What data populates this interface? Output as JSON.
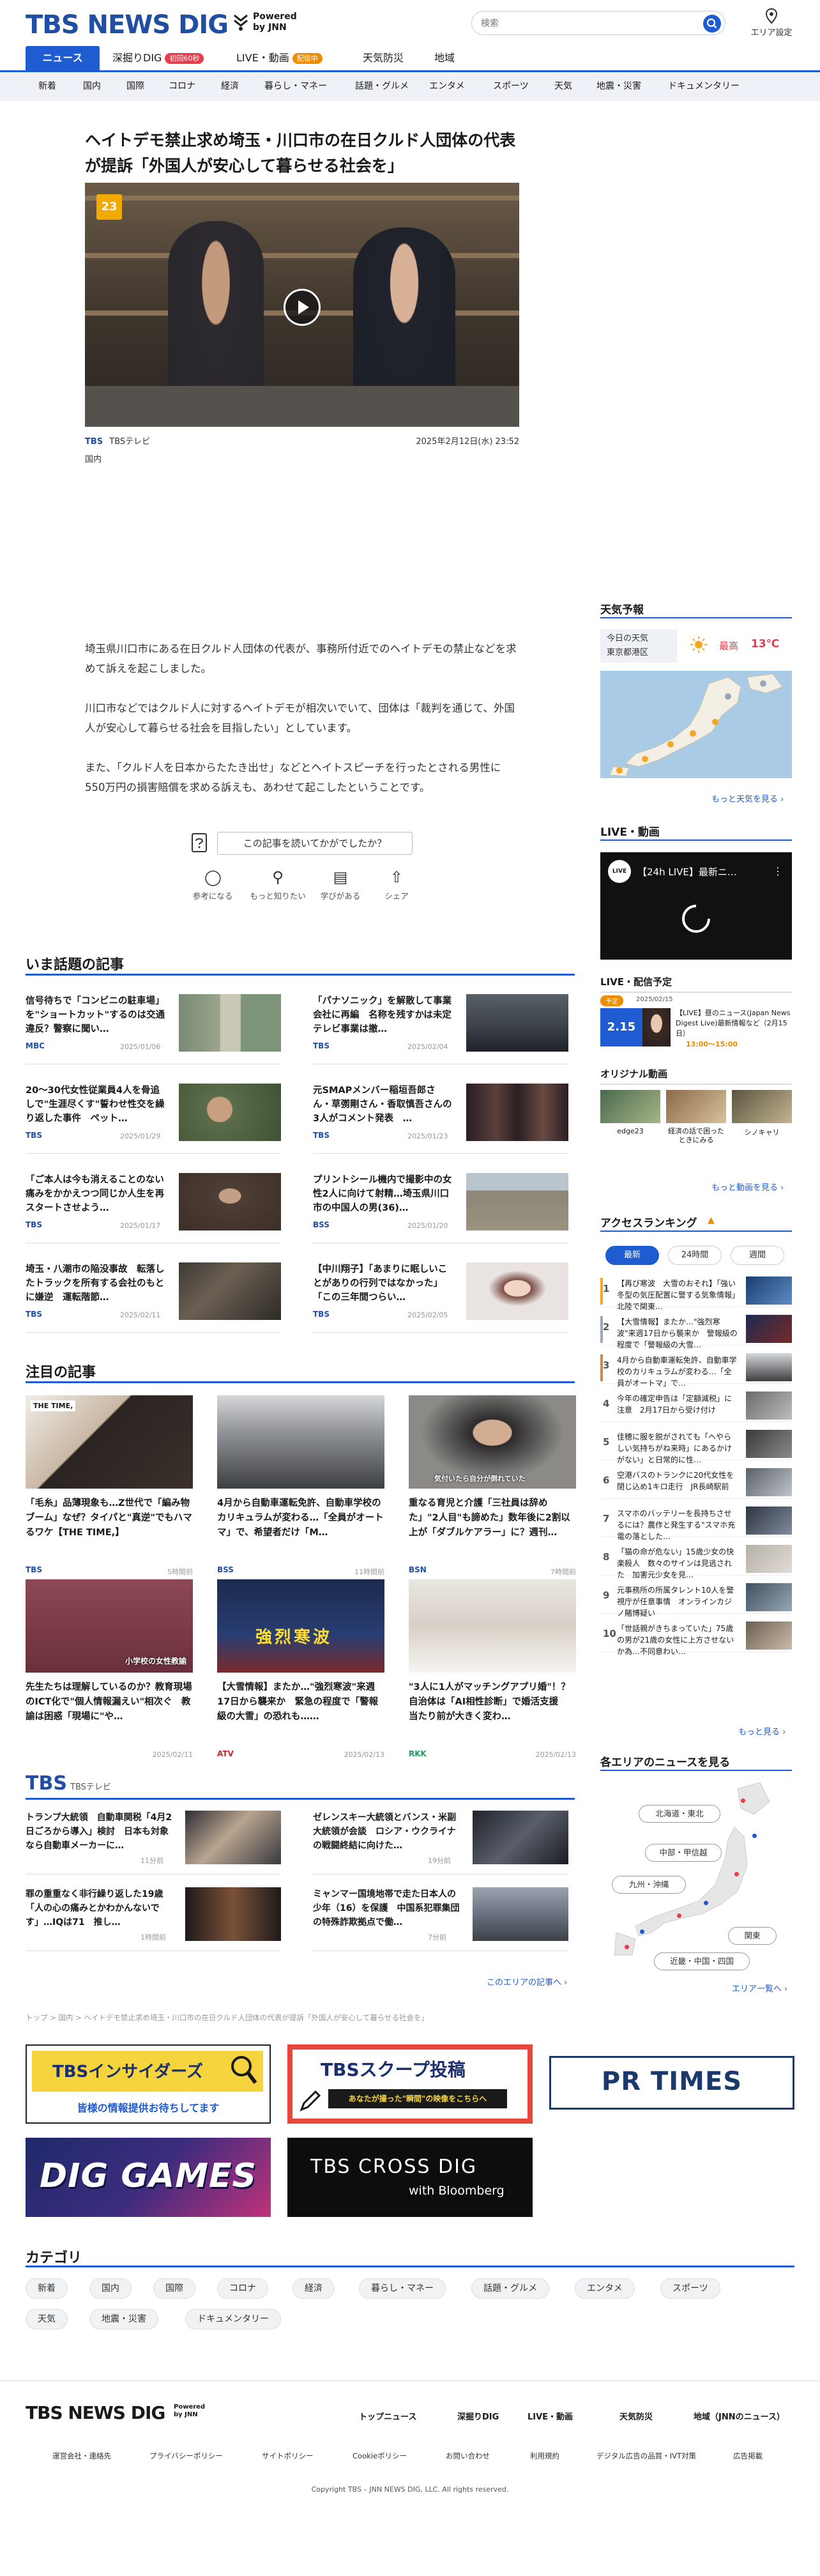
{
  "header": {
    "logo": "TBS NEWS DIG",
    "powered": "Powered",
    "by": "by JNN",
    "search_placeholder": "検索",
    "area_label": "エリア設定"
  },
  "nav": {
    "news": "ニュース",
    "deep_dig": "深掘りDIG",
    "deep_badge": "初回60秒",
    "live": "LIVE・動画",
    "live_badge": "配信中",
    "weather": "天気防災",
    "region": "地域"
  },
  "subnav": [
    "新着",
    "国内",
    "国際",
    "コロナ",
    "経済",
    "暮らし・マネー",
    "話題・グルメ",
    "エンタメ",
    "スポーツ",
    "天気",
    "地震・災害",
    "ドキュメンタリー"
  ],
  "article": {
    "title": "ヘイトデモ禁止求め埼玉・川口市の在日クルド人団体の代表が提訴「外国人が安心して暮らせる社会を」",
    "video_logo": "23",
    "source_logo": "TBS",
    "source_name": "TBSテレビ",
    "date": "2025年2月12日(水) 23:52",
    "category": "国内",
    "p1": "埼玉県川口市にある在日クルド人団体の代表が、事務所付近でのヘイトデモの禁止などを求めて訴えを起こしました。",
    "p2": "川口市などではクルド人に対するヘイトデモが相次いでいて、団体は「裁判を通じて、外国人が安心して暮らせる社会を目指したい」としています。",
    "p3": "また、「クルド人を日本からたたき出せ」などとヘイトスピーチを行ったとされる男性に550万円の損害賠償を求める訴えも、あわせて起こしたということです。",
    "survey": "この記事を読いてかがでしたか？",
    "reactions": [
      "参考になる",
      "もっと知りたい",
      "学びがある",
      "シェア"
    ]
  },
  "trending": {
    "heading": "いま話題の記事",
    "items": [
      {
        "title": "信号待ちで「コンビニの駐車場」を\"ショートカット\"するのは交通違反？警察に聞い…",
        "src": "MBC",
        "date": "2025/01/06"
      },
      {
        "title": "「パナソニック」を解散して事業会社に再編　名称を残すかは未定　テレビ事業は撤…",
        "src": "TBS",
        "date": "2025/02/04"
      },
      {
        "title": "20〜30代女性従業員4人を骨追しで\"生涯尽くす\"誓わせ性交を繰り返した事件　ペット…",
        "src": "TBS",
        "date": "2025/01/29"
      },
      {
        "title": "元SMAPメンバー稲垣吾郎さん・草彅剛さん・香取慎吾さんの3人がコメント発表　…",
        "src": "TBS",
        "date": "2025/01/23"
      },
      {
        "title": "「ご本人は今も消えることのない痛みをかかえつつ同じか人生を再スタートさせよう…",
        "src": "TBS",
        "date": "2025/01/17"
      },
      {
        "title": "プリントシール機内で撮影中の女性2人に向けて射精…埼玉県川口市の中国人の男(36)…",
        "src": "BSS",
        "date": "2025/01/20"
      },
      {
        "title": "埼玉・八潮市の陥没事故　転落したトラックを所有する会社のもとに嫌逆　運転階節…",
        "src": "TBS",
        "date": "2025/02/11"
      },
      {
        "title": "【中川翔子】「あまりに眠しいことがありの行列ではなかった」「この三年間つらい…",
        "src": "TBS",
        "date": "2025/02/05"
      }
    ]
  },
  "featured": {
    "heading": "注目の記事",
    "items": [
      {
        "title": "「毛糸」品薄現象も…Z世代で「編み物ブーム」なぜ？タイパと\"真逆\"でもハマるワケ【THE TIME,】",
        "src": "TBS",
        "date": "5時間前",
        "thumb_text": "THE TIME,"
      },
      {
        "title": "4月から自動車運転免許、自動車学校のカリキュラムが変わる…「全員がオートマ」で、希望者だけ「M…",
        "src": "BSS",
        "date": "11時間前",
        "thumb_text": ""
      },
      {
        "title": "重なる育児と介護「三社員は辞めた」\"2人目\"も諦めた」数年後に2割以上が「ダブルケアラー」に？週刊…",
        "src": "BSN",
        "date": "7時間前",
        "thumb_text": "気付いたら自分が倒れていた"
      },
      {
        "title": "先生たちは理解しているのか？教育現場のICT化で\"個人情報漏えい\"相次ぐ　教諭は困惑「現場に\"や…",
        "src": "",
        "date": "2025/02/11",
        "thumb_text": "小学校の女性教諭"
      },
      {
        "title": "【大雪情報】またか…\"強烈寒波\"来週17日から襲来か　緊急の程度で「警報級の大雪」の恐れも……",
        "src": "ATV",
        "date": "2025/02/13",
        "thumb_text": "強烈寒波"
      },
      {
        "title": "\"3人に1人がマッチングアプリ婚\"！？自治体は「AI相性診断」で婚活支援　当たり前が大きく変わ…",
        "src": "RKK",
        "date": "2025/02/13",
        "thumb_text": ""
      }
    ]
  },
  "tbs_section": {
    "logo": "TBS",
    "sub": "TBSテレビ",
    "items": [
      {
        "title": "トランプ大統領　自動車関税「4月2日ごろから導入」検討　日本も対象なら自動車メーカーに…",
        "date": "11分前"
      },
      {
        "title": "ゼレンスキー大統領とバンス・米副大統領が会談　ロシア・ウクライナの戦闘終結に向けた…",
        "date": "19分前"
      },
      {
        "title": "罪の重重なく非行繰り返した19歳「人の心の痛みとかわかんないです」…IQは71　推し…",
        "date": "1時間前"
      },
      {
        "title": "ミャンマー国境地帯で走た日本人の少年（16）を保護　中国系犯罪集団の特殊詐欺拠点で働…",
        "date": "7分前"
      }
    ],
    "more": "このエリアの記事へ ›"
  },
  "breadcrumb": "トップ > 国内 > ヘイトデモ禁止求め埼玉・川口市の在日クルド人団体の代表が提訴「外国人が安心して暮らせる社会を」",
  "sidebar": {
    "weather_h": "天気予報",
    "weather_today": "今日の天気",
    "weather_city": "東京都港区",
    "weather_label": "最高",
    "weather_temp": "13℃",
    "weather_more": "もっと天気を見る ›",
    "live_h": "LIVE・動画",
    "live_title": "【24h LIVE】最新ニ…",
    "live_sched_h": "LIVE・配信予定",
    "live_sched_badge": "予定",
    "live_sched_date": "2025/02/15",
    "live_sched_time": "2.15",
    "live_sched_title": "【LIVE】昼のニュース(Japan News Digest Live)最新情報など（2月15日）",
    "live_sched_hours": "13:00～15:00",
    "original_h": "オリジナル動画",
    "original": [
      "edge23",
      "経済の話で困ったときにみる",
      "シノキャリ"
    ],
    "video_more": "もっと動画を見る ›",
    "ranking_h": "アクセスランキング",
    "ranking_tabs": [
      "最新",
      "24時間",
      "週間"
    ],
    "ranking": [
      "【再び寒波　大雪のおそれ】「強い冬型の気圧配置に警する気象情報」北陸で関東…",
      "【大雪情報】またか…\"強烈寒波\"来週17日から襲来か　警報級の程度で「警報級の大雪…",
      "4月から自動車運転免許、自動車学校のカリキュラムが変わる…「全員がオートマ」で…",
      "今年の確定申告は「定額減税」に注意　2月17日から受け付け",
      "佳穂に服を脱がされても「ヘやらしい気持ちがね来時」にあるかけがない」と日常的に性…",
      "空港バスのトランクに20代女性を閉じ込め1キロ走行　JR長崎駅前",
      "スマホのバッテリーを長持ちさせるには？農作と発生する\"スマホ充電の落とした…",
      "「猫の命が危ない」15歳少女の快楽殺人　数々のサインは見逃された　加害元少女を見…",
      "元事務所の所属タレント10人を警視庁が任意事情　オンラインカジノ賭博疑い",
      "「世話親がきちまっていた」75歳の男が21歳の女性に上方させないか為…不同意わい…"
    ],
    "ranking_more": "もっと見る ›",
    "region_h": "各エリアのニュースを見る",
    "regions": [
      "北海道・東北",
      "中部・甲信越",
      "九州・沖縄",
      "関東",
      "近畿・中国・四国"
    ],
    "region_more": "エリア一覧へ ›"
  },
  "banners": [
    "TBSインサイダーズ",
    "皆様の情報提供お待ちしてます",
    "TBSスクープ投稿",
    "あなたが撮った\"瞬間\"の映像をこちらへ",
    "PR TIMES",
    "DIG GAMES",
    "TBS CROSS DIG",
    "with Bloomberg"
  ],
  "categories": {
    "heading": "カテゴリ",
    "items": [
      "新着",
      "国内",
      "国際",
      "コロナ",
      "経済",
      "暮らし・マネー",
      "話題・グルメ",
      "エンタメ",
      "スポーツ",
      "天気",
      "地震・災害",
      "ドキュメンタリー"
    ]
  },
  "footer": {
    "logo": "TBS NEWS DIG",
    "powered": "Powered",
    "by": "by JNN",
    "links": [
      "トップニュース",
      "深掘りDIG",
      "LIVE・動画",
      "天気防災",
      "地域（JNNのニュース）"
    ],
    "small": [
      "運営会社・連絡先",
      "プライバシーポリシー",
      "サイトポリシー",
      "Cookieポリシー",
      "お問い合わせ",
      "利用規約",
      "デジタル広告の品質・IVT対策",
      "広告掲載"
    ],
    "copyright": "Copyright TBS – JNN NEWS DIG, LLC. All rights reserved."
  },
  "colors": {
    "accent": "#1f5bd1",
    "logo": "#1f4ea3",
    "deep_badge": "#e63c4b",
    "live_badge": "#f08c00"
  }
}
